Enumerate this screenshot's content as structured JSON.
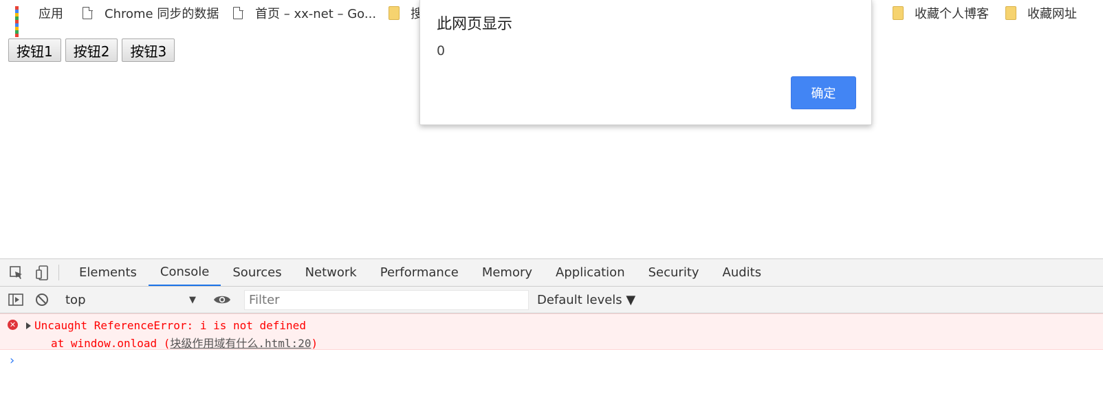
{
  "bookmarks": {
    "apps": "应用",
    "items": [
      {
        "label": "Chrome 同步的数据",
        "icon": "page-icon"
      },
      {
        "label": "首页 – xx-net – Go...",
        "icon": "page-icon"
      },
      {
        "label": "搜",
        "icon": "folder-icon"
      },
      {
        "label": "收藏个人博客",
        "icon": "folder-icon"
      },
      {
        "label": "收藏网址",
        "icon": "folder-icon"
      }
    ]
  },
  "page": {
    "buttons": [
      "按钮1",
      "按钮2",
      "按钮3"
    ]
  },
  "dialog": {
    "title": "此网页显示",
    "message": "0",
    "ok_label": "确定",
    "accent": "#4285f4"
  },
  "devtools": {
    "tabs": [
      "Elements",
      "Console",
      "Sources",
      "Network",
      "Performance",
      "Memory",
      "Application",
      "Security",
      "Audits"
    ],
    "active_tab": "Console",
    "context": "top",
    "filter_placeholder": "Filter",
    "levels": "Default levels ▼",
    "error": {
      "line1": "Uncaught ReferenceError: i is not defined",
      "line2_prefix": "at window.onload (",
      "link": "块级作用域有什么.html:20",
      "line2_suffix": ")"
    },
    "prompt": "›"
  }
}
